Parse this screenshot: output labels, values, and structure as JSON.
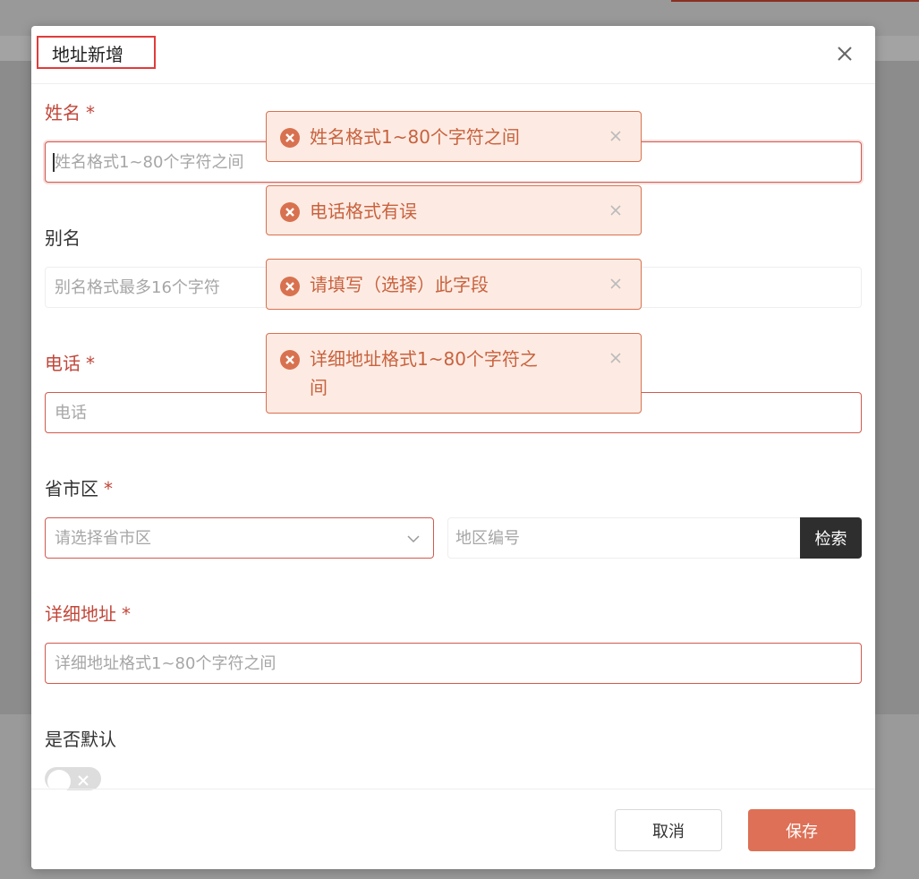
{
  "modal": {
    "title": "地址新增"
  },
  "form": {
    "name": {
      "label": "姓名",
      "required_mark": "*",
      "placeholder": "姓名格式1~80个字符之间",
      "value": ""
    },
    "alias": {
      "label": "别名",
      "placeholder": "别名格式最多16个字符",
      "value": ""
    },
    "phone": {
      "label": "电话",
      "required_mark": "*",
      "placeholder": "电话",
      "value": ""
    },
    "region": {
      "label": "省市区",
      "required_mark": "*",
      "select_placeholder": "请选择省市区",
      "code_placeholder": "地区编号",
      "search_label": "检索"
    },
    "address": {
      "label": "详细地址",
      "required_mark": "*",
      "placeholder": "详细地址格式1~80个字符之间",
      "value": ""
    },
    "default": {
      "label": "是否默认",
      "enabled": false
    }
  },
  "footer": {
    "cancel_label": "取消",
    "save_label": "保存"
  },
  "toasts": [
    {
      "message": "姓名格式1~80个字符之间"
    },
    {
      "message": "电话格式有误"
    },
    {
      "message": "请填写（选择）此字段"
    },
    {
      "message": "详细地址格式1~80个字符之间"
    }
  ],
  "colors": {
    "error": "#c2473a",
    "primary": "#dd7057",
    "toast_bg": "#fdebe3",
    "search_button": "#2e2e2e"
  },
  "icons": {
    "close": "close-icon",
    "toast_error": "error-circle-icon",
    "select": "chevron-down-icon",
    "toggle_off": "x-icon"
  }
}
